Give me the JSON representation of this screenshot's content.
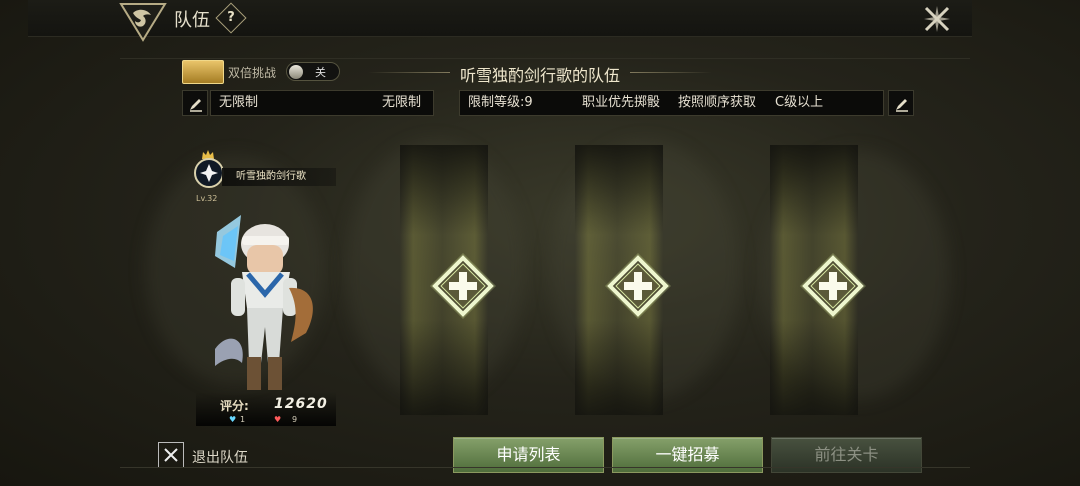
{
  "header": {
    "title": "队伍",
    "help_icon": "question-icon",
    "close_icon": "close-icon"
  },
  "toolbar": {
    "double_challenge_label": "双倍挑战",
    "toggle_label": "关",
    "team_title": "听雪独酌剑行歌的队伍"
  },
  "filters": {
    "left_value_1": "无限制",
    "left_value_2": "无限制",
    "restrictions": [
      "限制等级:9",
      "职业优先掷骰",
      "按照顺序获取",
      "C级以上"
    ]
  },
  "leader": {
    "name": "听雪独酌剑行歌",
    "level": "Lv.32",
    "score_label": "评分:",
    "score": "12620",
    "blue_count": "1",
    "red_count": "9"
  },
  "slots": [
    {
      "icon": "add-member-icon"
    },
    {
      "icon": "add-member-icon"
    },
    {
      "icon": "add-member-icon"
    }
  ],
  "footer": {
    "exit_label": "退出队伍",
    "buttons": [
      "申请列表",
      "一键招募",
      "前往关卡"
    ]
  },
  "colors": {
    "accent_green": "#6f8e52",
    "gold": "#d6b04d",
    "background": "#24231a"
  }
}
